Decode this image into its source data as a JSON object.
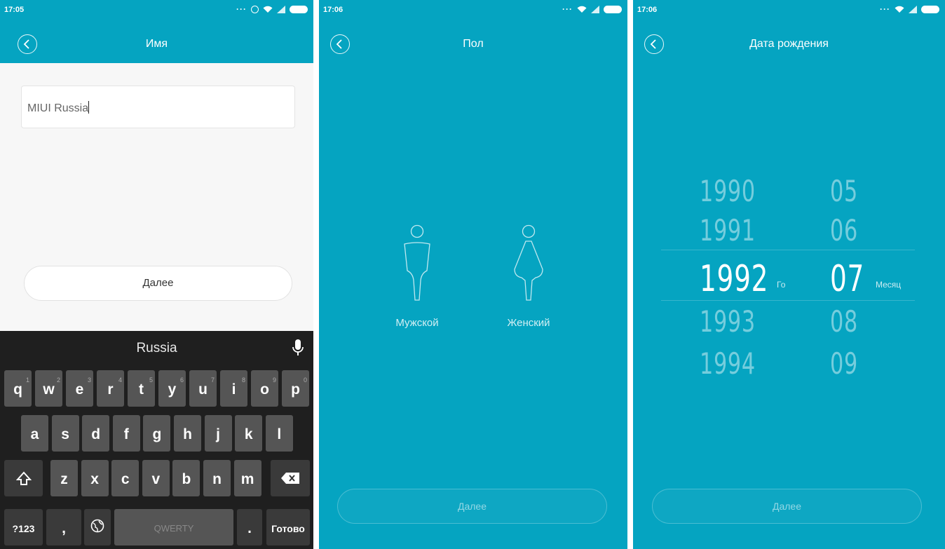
{
  "panel1": {
    "status_time": "17:05",
    "title": "Имя",
    "name_value": "MIUI Russia",
    "next_label": "Далее",
    "keyboard": {
      "suggestion": "Russia",
      "row1": [
        {
          "k": "q",
          "h": "1"
        },
        {
          "k": "w",
          "h": "2"
        },
        {
          "k": "e",
          "h": "3"
        },
        {
          "k": "r",
          "h": "4"
        },
        {
          "k": "t",
          "h": "5"
        },
        {
          "k": "y",
          "h": "6"
        },
        {
          "k": "u",
          "h": "7"
        },
        {
          "k": "i",
          "h": "8"
        },
        {
          "k": "o",
          "h": "9"
        },
        {
          "k": "p",
          "h": "0"
        }
      ],
      "row2": [
        "a",
        "s",
        "d",
        "f",
        "g",
        "h",
        "j",
        "k",
        "l"
      ],
      "row3": [
        "z",
        "x",
        "c",
        "v",
        "b",
        "n",
        "m"
      ],
      "symbols_key": "?123",
      "comma_key": ",",
      "space_label": "QWERTY",
      "period_key": ".",
      "done_key": "Готово"
    }
  },
  "panel2": {
    "status_time": "17:06",
    "title": "Пол",
    "male_label": "Мужской",
    "female_label": "Женский",
    "next_label": "Далее"
  },
  "panel3": {
    "status_time": "17:06",
    "title": "Дата рождения",
    "years": [
      "1990",
      "1991",
      "1992",
      "1993",
      "1994"
    ],
    "months": [
      "05",
      "06",
      "07",
      "08",
      "09"
    ],
    "selected_index": 2,
    "year_unit": "Го",
    "month_unit": "Месяц",
    "next_label": "Далее"
  },
  "colors": {
    "accent": "#05a4c1",
    "keyboard_bg": "#1f1f1f",
    "key_bg": "#555555"
  }
}
